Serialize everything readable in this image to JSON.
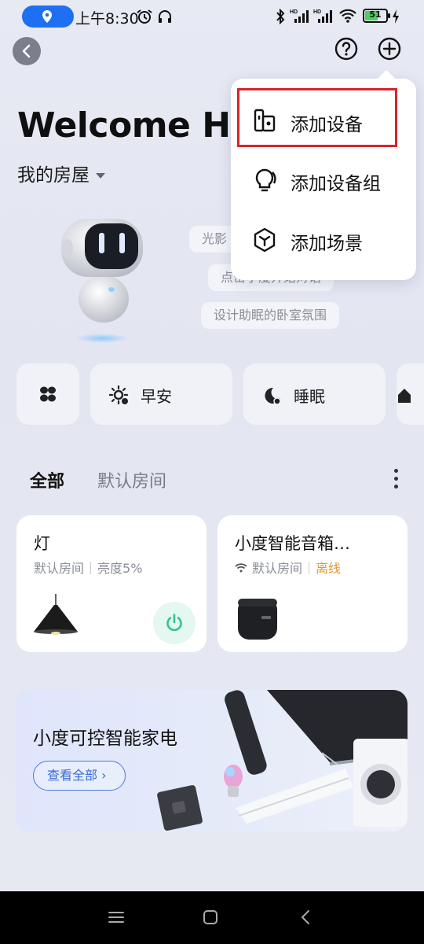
{
  "status_bar": {
    "time": "上午8:30",
    "battery": "51",
    "icons": [
      "location-icon",
      "alarm-icon",
      "headphones-icon",
      "bluetooth-icon",
      "signal-hd-icon",
      "signal-hd-icon",
      "wifi-icon",
      "battery-icon",
      "charging-icon"
    ]
  },
  "header": {
    "welcome": "Welcome Ho",
    "home_name": "我的房屋"
  },
  "suggestions": [
    "光影",
    "点击小度开始对话",
    "设计助眠的卧室氛围"
  ],
  "scene_chips": [
    {
      "icon": "grid-icon",
      "label": ""
    },
    {
      "icon": "sun-icon",
      "label": "早安"
    },
    {
      "icon": "moon-icon",
      "label": "睡眠"
    }
  ],
  "tabs": {
    "active": "全部",
    "room": "默认房间"
  },
  "devices": [
    {
      "title": "灯",
      "room": "默认房间",
      "status": "亮度5%",
      "power_on": true
    },
    {
      "title": "小度智能音箱…",
      "room": "默认房间",
      "status": "离线"
    }
  ],
  "banner": {
    "title": "小度可控智能家电",
    "button": "查看全部 ›"
  },
  "menu": {
    "items": [
      {
        "label": "添加设备",
        "icon": "device-add-icon"
      },
      {
        "label": "添加设备组",
        "icon": "bulb-group-icon"
      },
      {
        "label": "添加场景",
        "icon": "hexagon-scene-icon"
      }
    ]
  },
  "colors": {
    "accent": "#1e6ff2",
    "highlight": "#d9242b",
    "offline": "#e3972b",
    "power": "#2fc48f"
  }
}
